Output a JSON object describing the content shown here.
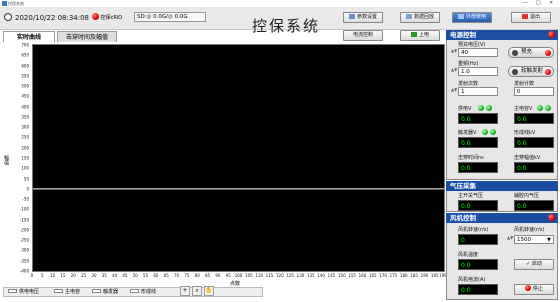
{
  "window": {
    "title": "控保系统",
    "minimize": "—",
    "maximize": "□",
    "close": "✕"
  },
  "header": {
    "datetime": "2020/10/22 08:34:08",
    "ctrl_label": "控保cRIO",
    "sd_label": "SD:",
    "sd_used": "0.0G",
    "sd_total": "0.0G",
    "title": "控保系统"
  },
  "buttons": {
    "param": "参数设置",
    "data": "数据回放",
    "external": "外部使用",
    "exit": "退出",
    "power": "电流控制",
    "power_on": "上电"
  },
  "tabs": [
    "实时曲线",
    "击穿时间及幅值"
  ],
  "chart_data": {
    "type": "line",
    "ylabel": "幅值",
    "xlabel": "点数",
    "ylim": [
      -400,
      700
    ],
    "xlim": [
      0,
      199
    ],
    "yticks": [
      "700",
      "650",
      "600",
      "550",
      "500",
      "450",
      "400",
      "350",
      "300",
      "250",
      "200",
      "150",
      "100",
      "50",
      "0",
      "-50",
      "-100",
      "-150",
      "-200",
      "-250",
      "-300",
      "-350",
      "-400"
    ],
    "xticks": [
      "0",
      "5",
      "10",
      "15",
      "20",
      "25",
      "30",
      "35",
      "40",
      "45",
      "50",
      "55",
      "60",
      "65",
      "70",
      "75",
      "80",
      "85",
      "90",
      "95",
      "100",
      "105",
      "110",
      "115",
      "120",
      "125",
      "130",
      "135",
      "140",
      "145",
      "150",
      "155",
      "160",
      "165",
      "170",
      "175",
      "180",
      "185",
      "190",
      "195",
      "199"
    ],
    "series_line_y": 0,
    "legend": [
      "供电电压",
      "主电容",
      "触发器",
      "形成线"
    ]
  },
  "power_control": {
    "title": "电源控制",
    "charge_voltage_label": "预充电压(V)",
    "charge_voltage": "40",
    "precharge_button": "预充",
    "freq_label": "重频(Hz)",
    "freq": "1.0",
    "soft_trigger_button": "软触发射",
    "count_label": "发射次数",
    "count": "1",
    "shots_label": "发射计数",
    "shots": "0",
    "supply_v_label": "供电V",
    "supply_v": "0.0",
    "main_cap_label": "主电容V",
    "main_cap": "0.0",
    "trigger_v_label": "触发器V",
    "trigger_v": "0.0",
    "pfl_label": "形成线kV",
    "pfl": "0.0",
    "bd_time_label": "击穿时间ns",
    "bd_time": "0.0",
    "bd_amp_label": "击穿幅值kV",
    "bd_amp": "0.0"
  },
  "gas": {
    "title": "气压采集",
    "main_switch_label": "主开关气压",
    "main_switch": "0.0",
    "aux_label": "辅腔内气压",
    "aux": "0.0"
  },
  "fan": {
    "title": "风机控制",
    "speed_label": "风机转速(r/s)",
    "speed": "0",
    "set_label": "风机转速(r/s)",
    "set_value": "1500",
    "temp_label": "风机温度",
    "temp": "0.0",
    "start_button": "启动",
    "current_label": "风机电流(A)",
    "current": "0.0",
    "stop_button": "停止"
  }
}
